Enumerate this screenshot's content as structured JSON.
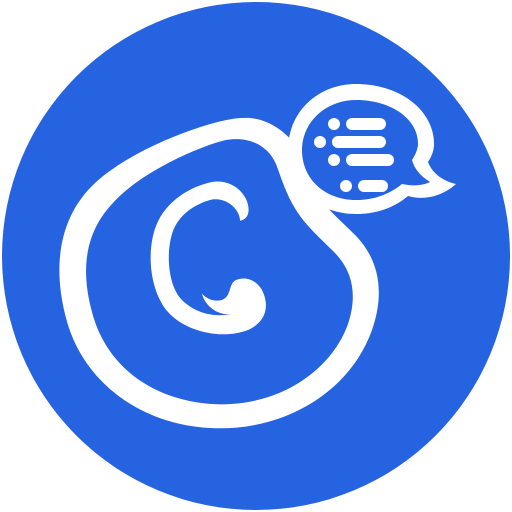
{
  "logo": {
    "name": "app-logo",
    "icon": "g-letter-with-chat-bubble-icon",
    "colors": {
      "background": "#2563E0",
      "foreground": "#ffffff"
    }
  }
}
